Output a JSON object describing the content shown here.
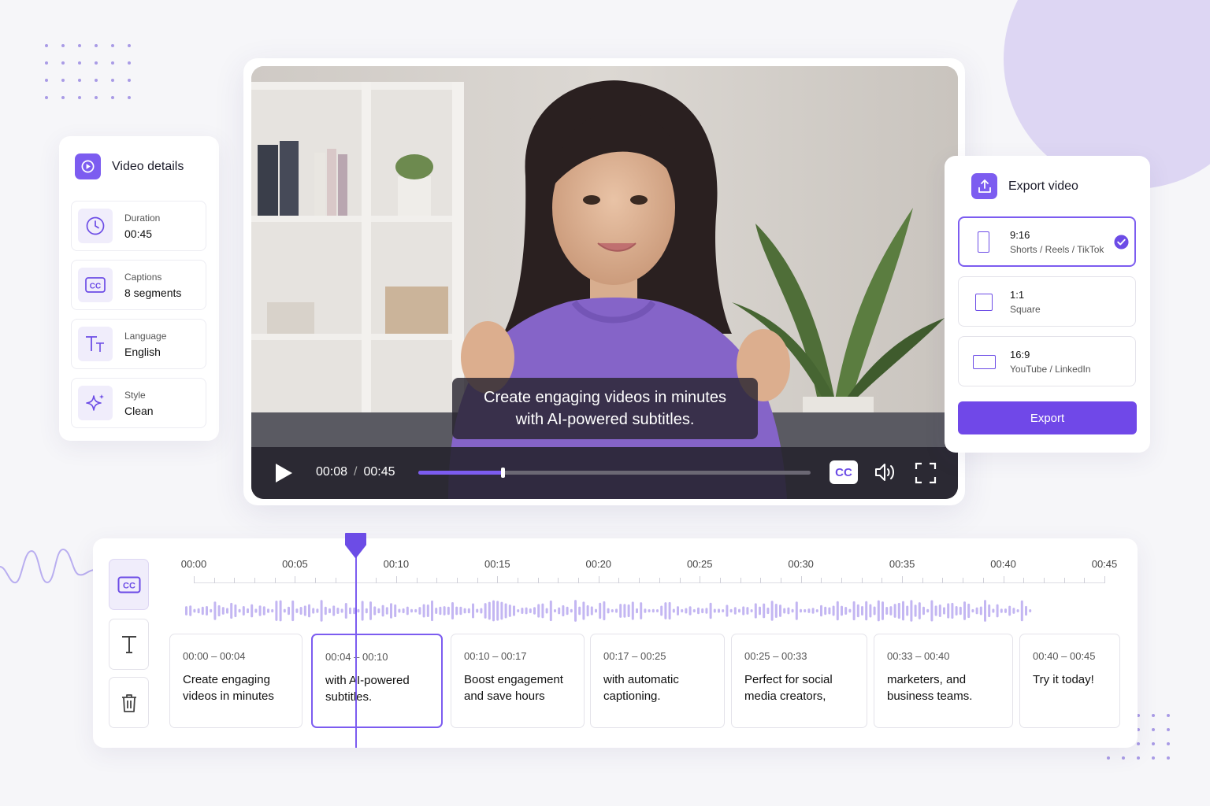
{
  "details": {
    "title": "Video details",
    "items": [
      {
        "label": "Duration",
        "value": "00:45"
      },
      {
        "label": "Captions",
        "value": "8 segments"
      },
      {
        "label": "Language",
        "value": "English"
      },
      {
        "label": "Style",
        "value": "Clean"
      }
    ]
  },
  "player": {
    "caption_line1": "Create engaging videos in minutes",
    "caption_line2": "with AI-powered subtitles.",
    "current_time": "00:08",
    "separator": "/",
    "total_time": "00:45",
    "progress": 0.215,
    "cc_label": "CC"
  },
  "export": {
    "title": "Export video",
    "options": [
      {
        "ratio": "9:16",
        "desc": "Shorts / Reels / TikTok",
        "selected": true
      },
      {
        "ratio": "1:1",
        "desc": "Square",
        "selected": false
      },
      {
        "ratio": "16:9",
        "desc": "YouTube / LinkedIn",
        "selected": false
      }
    ],
    "button": "Export"
  },
  "timeline": {
    "cc_tool": "CC",
    "ticks": [
      "00:00",
      "00:05",
      "00:10",
      "00:15",
      "00:20",
      "00:25",
      "00:30",
      "00:35",
      "00:40",
      "00:45"
    ],
    "playhead_seconds": 8,
    "segments": [
      {
        "time": "00:00 – 00:04",
        "text": "Create engaging videos in minutes",
        "selected": false
      },
      {
        "time": "00:04 – 00:10",
        "text": "with AI-powered subtitles.",
        "selected": true
      },
      {
        "time": "00:10 – 00:17",
        "text": "Boost engagement and save hours",
        "selected": false
      },
      {
        "time": "00:17 – 00:25",
        "text": "with automatic captioning.",
        "selected": false
      },
      {
        "time": "00:25 – 00:33",
        "text": "Perfect for social media creators,",
        "selected": false
      },
      {
        "time": "00:33 – 00:40",
        "text": "marketers, and business teams.",
        "selected": false
      },
      {
        "time": "00:40 – 00:45",
        "text": "Try it today!",
        "selected": false
      }
    ]
  },
  "colors": {
    "accent": "#7c5cf0",
    "accent_dark": "#6c4ce6",
    "bg": "#f6f6f9"
  }
}
